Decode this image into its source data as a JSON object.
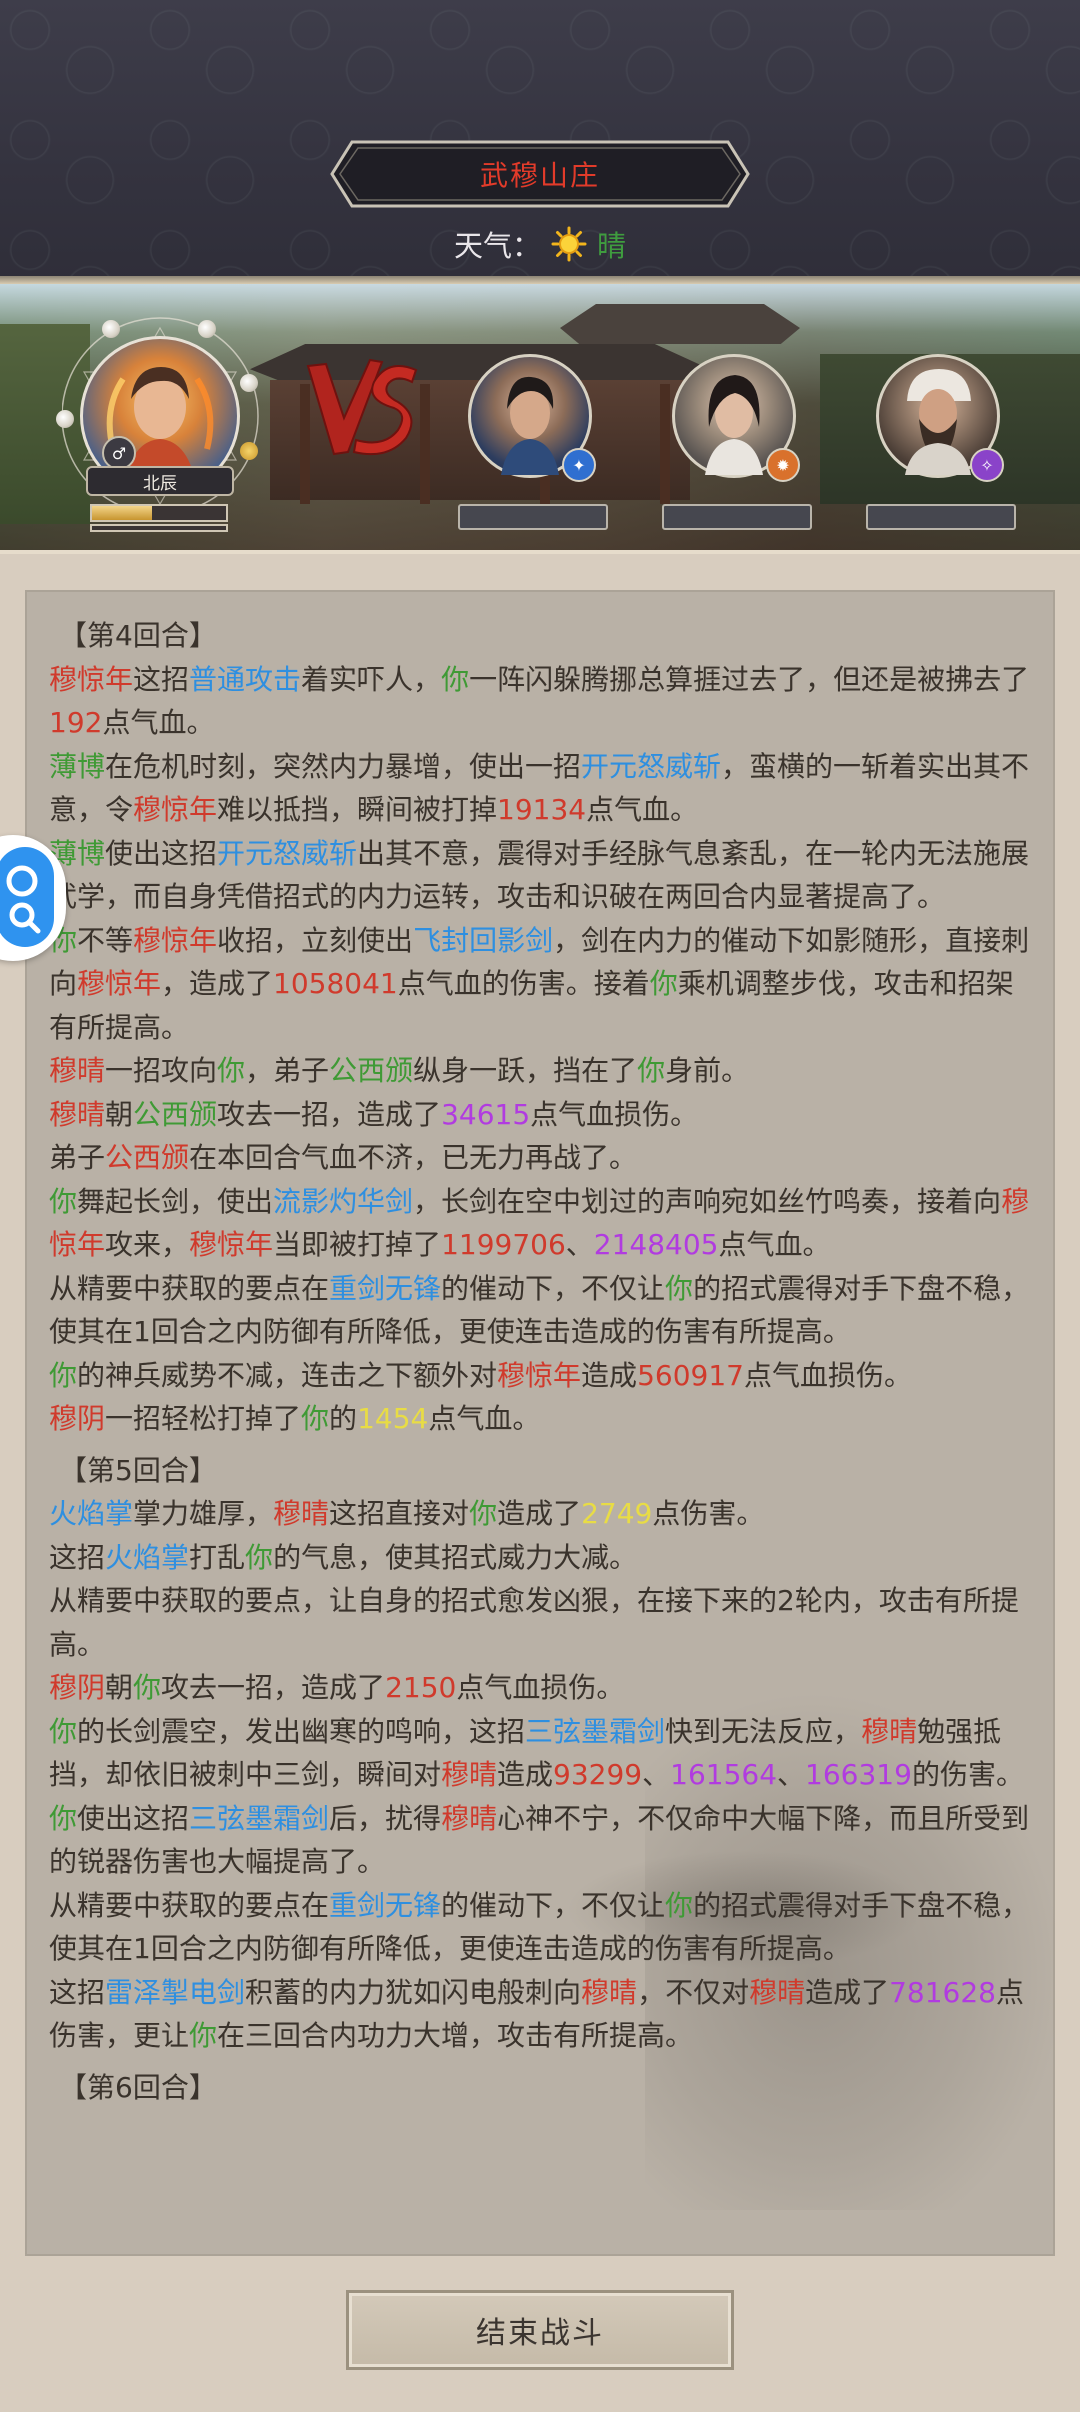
{
  "header": {
    "location": "武穆山庄",
    "weather_label": "天气：",
    "weather_icon": "sun-icon",
    "weather_value": "晴"
  },
  "battle": {
    "player": {
      "name": "北辰",
      "gender_icon": "male-icon",
      "hp_fraction": 0.45
    },
    "vs_icon": "vs-icon",
    "enemies": [
      {
        "portrait": "male-warrior-portrait",
        "element_icon": "water-element-icon",
        "element_color": "#2f6fd0"
      },
      {
        "portrait": "male-swordsman-portrait",
        "element_icon": "fire-element-icon",
        "element_color": "#d9712c"
      },
      {
        "portrait": "bearded-elder-portrait",
        "element_icon": "purple-element-icon",
        "element_color": "#8a43c9"
      }
    ]
  },
  "colors": {
    "red": "#d03a2c",
    "blue": "#2e8fe0",
    "green": "#3f9a35",
    "purple": "#b13be0",
    "yellow": "#e8dc45"
  },
  "log": [
    {
      "type": "round",
      "segments": [
        {
          "t": "【第4回合】"
        }
      ]
    },
    {
      "type": "line",
      "segments": [
        {
          "t": "穆惊年",
          "c": "red"
        },
        {
          "t": "这招"
        },
        {
          "t": "普通攻击",
          "c": "blue"
        },
        {
          "t": "着实吓人，"
        },
        {
          "t": "你",
          "c": "green"
        },
        {
          "t": "一阵闪躲腾挪总算捱过去了，但还是被拂去了"
        },
        {
          "t": "192",
          "c": "red"
        },
        {
          "t": "点气血。"
        }
      ]
    },
    {
      "type": "line",
      "segments": [
        {
          "t": "薄博",
          "c": "green"
        },
        {
          "t": "在危机时刻，突然内力暴增，使出一招"
        },
        {
          "t": "开元怒威斩",
          "c": "blue"
        },
        {
          "t": "，蛮横的一斩着实出其不意，令"
        },
        {
          "t": "穆惊年",
          "c": "red"
        },
        {
          "t": "难以抵挡，瞬间被打掉"
        },
        {
          "t": "19134",
          "c": "red"
        },
        {
          "t": "点气血。"
        }
      ]
    },
    {
      "type": "line",
      "segments": [
        {
          "t": "薄博",
          "c": "green"
        },
        {
          "t": "使出这招"
        },
        {
          "t": "开元怒威斩",
          "c": "blue"
        },
        {
          "t": "出其不意，震得对手经脉气息紊乱，在一轮内无法施展武学，而自身凭借招式的内力运转，攻击和识破在两回合内显著提高了。"
        }
      ]
    },
    {
      "type": "line",
      "segments": [
        {
          "t": "你",
          "c": "green"
        },
        {
          "t": "不等"
        },
        {
          "t": "穆惊年",
          "c": "red"
        },
        {
          "t": "收招，立刻使出"
        },
        {
          "t": "飞封回影剑",
          "c": "blue"
        },
        {
          "t": "，剑在内力的催动下如影随形，直接刺向"
        },
        {
          "t": "穆惊年",
          "c": "red"
        },
        {
          "t": "，造成了"
        },
        {
          "t": "1058041",
          "c": "red"
        },
        {
          "t": "点气血的伤害。接着"
        },
        {
          "t": "你",
          "c": "green"
        },
        {
          "t": "乘机调整步伐，攻击和招架有所提高。"
        }
      ]
    },
    {
      "type": "line",
      "segments": [
        {
          "t": "穆晴",
          "c": "red"
        },
        {
          "t": "一招攻向"
        },
        {
          "t": "你",
          "c": "green"
        },
        {
          "t": "，弟子"
        },
        {
          "t": "公西颁",
          "c": "green"
        },
        {
          "t": "纵身一跃，挡在了"
        },
        {
          "t": "你",
          "c": "green"
        },
        {
          "t": "身前。"
        }
      ]
    },
    {
      "type": "line",
      "segments": [
        {
          "t": "穆晴",
          "c": "red"
        },
        {
          "t": "朝"
        },
        {
          "t": "公西颁",
          "c": "green"
        },
        {
          "t": "攻去一招，造成了"
        },
        {
          "t": "34615",
          "c": "purple"
        },
        {
          "t": "点气血损伤。"
        }
      ]
    },
    {
      "type": "line",
      "segments": [
        {
          "t": "弟子"
        },
        {
          "t": "公西颁",
          "c": "red"
        },
        {
          "t": "在本回合气血不济，已无力再战了。"
        }
      ]
    },
    {
      "type": "line",
      "segments": [
        {
          "t": "你",
          "c": "green"
        },
        {
          "t": "舞起长剑，使出"
        },
        {
          "t": "流影灼华剑",
          "c": "blue"
        },
        {
          "t": "，长剑在空中划过的声响宛如丝竹鸣奏，接着向"
        },
        {
          "t": "穆惊年",
          "c": "red"
        },
        {
          "t": "攻来，"
        },
        {
          "t": "穆惊年",
          "c": "red"
        },
        {
          "t": "当即被打掉了"
        },
        {
          "t": "1199706",
          "c": "red"
        },
        {
          "t": "、"
        },
        {
          "t": "2148405",
          "c": "purple"
        },
        {
          "t": "点气血。"
        }
      ]
    },
    {
      "type": "line",
      "segments": [
        {
          "t": "从精要中获取的要点在"
        },
        {
          "t": "重剑无锋",
          "c": "blue"
        },
        {
          "t": "的催动下，不仅让"
        },
        {
          "t": "你",
          "c": "green"
        },
        {
          "t": "的招式震得对手下盘不稳，使其在1回合之内防御有所降低，更使连击造成的伤害有所提高。"
        }
      ]
    },
    {
      "type": "line",
      "segments": [
        {
          "t": "你",
          "c": "green"
        },
        {
          "t": "的神兵威势不减，连击之下额外对"
        },
        {
          "t": "穆惊年",
          "c": "red"
        },
        {
          "t": "造成"
        },
        {
          "t": "560917",
          "c": "red"
        },
        {
          "t": "点气血损伤。"
        }
      ]
    },
    {
      "type": "line",
      "segments": [
        {
          "t": "穆阴",
          "c": "red"
        },
        {
          "t": "一招轻松打掉了"
        },
        {
          "t": "你",
          "c": "green"
        },
        {
          "t": "的"
        },
        {
          "t": "1454",
          "c": "yellow"
        },
        {
          "t": "点气血。"
        }
      ]
    },
    {
      "type": "round",
      "segments": [
        {
          "t": "【第5回合】"
        }
      ]
    },
    {
      "type": "line",
      "segments": [
        {
          "t": "火焰掌",
          "c": "blue"
        },
        {
          "t": "掌力雄厚，"
        },
        {
          "t": "穆晴",
          "c": "red"
        },
        {
          "t": "这招直接对"
        },
        {
          "t": "你",
          "c": "green"
        },
        {
          "t": "造成了"
        },
        {
          "t": "2749",
          "c": "yellow"
        },
        {
          "t": "点伤害。"
        }
      ]
    },
    {
      "type": "line",
      "segments": [
        {
          "t": "这招"
        },
        {
          "t": "火焰掌",
          "c": "blue"
        },
        {
          "t": "打乱"
        },
        {
          "t": "你",
          "c": "green"
        },
        {
          "t": "的气息，使其招式威力大减。"
        }
      ]
    },
    {
      "type": "line",
      "segments": [
        {
          "t": "从精要中获取的要点，让自身的招式愈发凶狠，在接下来的2轮内，攻击有所提高。"
        }
      ]
    },
    {
      "type": "line",
      "segments": [
        {
          "t": "穆阴",
          "c": "red"
        },
        {
          "t": "朝"
        },
        {
          "t": "你",
          "c": "green"
        },
        {
          "t": "攻去一招，造成了"
        },
        {
          "t": "2150",
          "c": "red"
        },
        {
          "t": "点气血损伤。"
        }
      ]
    },
    {
      "type": "line",
      "segments": [
        {
          "t": "你",
          "c": "green"
        },
        {
          "t": "的长剑震空，发出幽寒的鸣响，这招"
        },
        {
          "t": "三弦墨霜剑",
          "c": "blue"
        },
        {
          "t": "快到无法反应，"
        },
        {
          "t": "穆晴",
          "c": "red"
        },
        {
          "t": "勉强抵挡，却依旧被刺中三剑，瞬间对"
        },
        {
          "t": "穆晴",
          "c": "red"
        },
        {
          "t": "造成"
        },
        {
          "t": "93299",
          "c": "red"
        },
        {
          "t": "、"
        },
        {
          "t": "161564",
          "c": "purple"
        },
        {
          "t": "、"
        },
        {
          "t": "166319",
          "c": "purple"
        },
        {
          "t": "的伤害。"
        }
      ]
    },
    {
      "type": "line",
      "segments": [
        {
          "t": "你",
          "c": "green"
        },
        {
          "t": "使出这招"
        },
        {
          "t": "三弦墨霜剑",
          "c": "blue"
        },
        {
          "t": "后，扰得"
        },
        {
          "t": "穆晴",
          "c": "red"
        },
        {
          "t": "心神不宁，不仅命中大幅下降，而且所受到的锐器伤害也大幅提高了。"
        }
      ]
    },
    {
      "type": "line",
      "segments": [
        {
          "t": "从精要中获取的要点在"
        },
        {
          "t": "重剑无锋",
          "c": "blue"
        },
        {
          "t": "的催动下，不仅让"
        },
        {
          "t": "你",
          "c": "green"
        },
        {
          "t": "的招式震得对手下盘不稳，使其在1回合之内防御有所降低，更使连击造成的伤害有所提高。"
        }
      ]
    },
    {
      "type": "line",
      "segments": [
        {
          "t": "这招"
        },
        {
          "t": "雷泽掣电剑",
          "c": "blue"
        },
        {
          "t": "积蓄的内力犹如闪电般刺向"
        },
        {
          "t": "穆晴",
          "c": "red"
        },
        {
          "t": "，不仅对"
        },
        {
          "t": "穆晴",
          "c": "red"
        },
        {
          "t": "造成了"
        },
        {
          "t": "781628",
          "c": "purple"
        },
        {
          "t": "点伤害，更让"
        },
        {
          "t": "你",
          "c": "green"
        },
        {
          "t": "在三回合内功力大增，攻击有所提高。"
        }
      ]
    },
    {
      "type": "round",
      "segments": [
        {
          "t": "【第6回合】"
        }
      ]
    }
  ],
  "actions": {
    "end_battle_label": "结束战斗",
    "search_icon": "search-icon"
  }
}
